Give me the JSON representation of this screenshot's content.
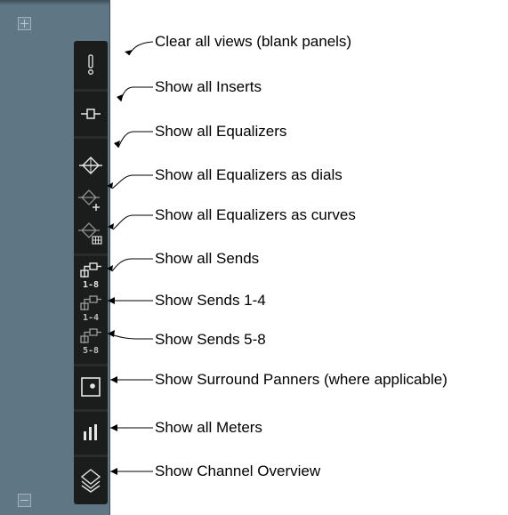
{
  "panel": {
    "expand_icon": "plus-square-icon",
    "collapse_icon": "minus-square-icon",
    "background_color": "#5f7684",
    "strip_color": "#1b1c1c"
  },
  "buttons": [
    {
      "id": "clear-views",
      "icon": "exclamation-icon",
      "label": "Clear all views (blank panels)"
    },
    {
      "id": "inserts",
      "icon": "insert-icon",
      "label": "Show all Inserts"
    },
    {
      "id": "equalizers",
      "icon": "eq-diamond-icon",
      "label": "Show all Equalizers"
    },
    {
      "id": "eq-dials",
      "icon": "eq-dials-icon",
      "label": "Show all Equalizers as dials"
    },
    {
      "id": "eq-curves",
      "icon": "eq-curves-icon",
      "label": "Show all Equalizers as curves"
    },
    {
      "id": "sends-all",
      "icon": "sends-1-8-icon",
      "label": "Show all Sends",
      "icon_text": "1-8"
    },
    {
      "id": "sends-1-4",
      "icon": "sends-1-4-icon",
      "label": "Show Sends 1-4",
      "icon_text": "1-4"
    },
    {
      "id": "sends-5-8",
      "icon": "sends-5-8-icon",
      "label": "Show Sends 5-8",
      "icon_text": "5-8"
    },
    {
      "id": "surround",
      "icon": "surround-panner-icon",
      "label": "Show Surround Panners (where applicable)"
    },
    {
      "id": "meters",
      "icon": "meter-bars-icon",
      "label": "Show all Meters"
    },
    {
      "id": "overview",
      "icon": "layers-icon",
      "label": "Show Channel Overview"
    }
  ]
}
